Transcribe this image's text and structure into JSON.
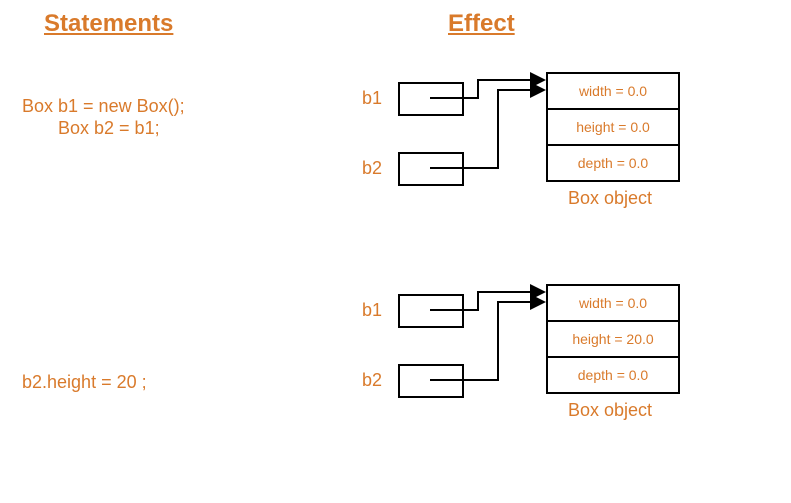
{
  "headings": {
    "statements": "Statements",
    "effect": "Effect"
  },
  "block1": {
    "code1": "Box b1 = new Box();",
    "code2": "Box b2 = b1;",
    "ref1": "b1",
    "ref2": "b2",
    "field_width": "width = 0.0",
    "field_height": "height = 0.0",
    "field_depth": "depth = 0.0",
    "object_label": "Box object"
  },
  "block2": {
    "code1": "b2.height = 20 ;",
    "ref1": "b1",
    "ref2": "b2",
    "field_width": "width = 0.0",
    "field_height": "height = 20.0",
    "field_depth": "depth = 0.0",
    "object_label": "Box object"
  }
}
